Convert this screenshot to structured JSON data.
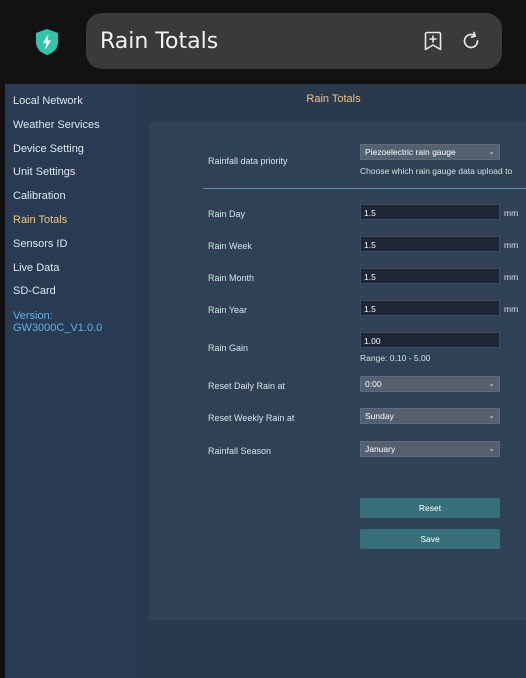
{
  "header": {
    "title": "Rain Totals"
  },
  "sidebar": {
    "items": [
      {
        "label": "Local Network"
      },
      {
        "label": "Weather Services"
      },
      {
        "label": "Device Setting"
      },
      {
        "label": "Unit Settings"
      },
      {
        "label": "Calibration"
      },
      {
        "label": "Rain Totals"
      },
      {
        "label": "Sensors ID"
      },
      {
        "label": "Live Data"
      },
      {
        "label": "SD-Card"
      }
    ],
    "active_item": "Rain Totals",
    "version": "Version: GW3000C_V1.0.0"
  },
  "main": {
    "heading": "Rain Totals",
    "priority": {
      "label": "Rainfall data priority",
      "value": "Piezoelectric rain gauge",
      "hint": "Choose which rain gauge data upload to"
    },
    "rain_day": {
      "label": "Rain Day",
      "value": "1.5",
      "unit": "mm"
    },
    "rain_week": {
      "label": "Rain Week",
      "value": "1.5",
      "unit": "mm"
    },
    "rain_month": {
      "label": "Rain Month",
      "value": "1.5",
      "unit": "mm"
    },
    "rain_year": {
      "label": "Rain Year",
      "value": "1.5",
      "unit": "mm"
    },
    "rain_gain": {
      "label": "Rain Gain",
      "value": "1.00",
      "range": "Range: 0.10 - 5.00"
    },
    "reset_daily": {
      "label": "Reset Daily Rain at",
      "value": "0:00"
    },
    "reset_weekly": {
      "label": "Reset Weekly Rain at",
      "value": "Sunday"
    },
    "season": {
      "label": "Rainfall Season",
      "value": "January"
    },
    "reset_button": "Reset",
    "save_button": "Save"
  },
  "colors": {
    "accent": "#f2c27a",
    "version_link": "#5fb3e8",
    "sidebar_bg": "#283b52",
    "main_bg": "#2a3a4c",
    "button_bg": "#37707a",
    "shield": "#33c3a8"
  },
  "icons": {
    "app": "shield-bolt-icon",
    "bookmark": "bookmark-add-icon",
    "refresh": "refresh-icon"
  }
}
